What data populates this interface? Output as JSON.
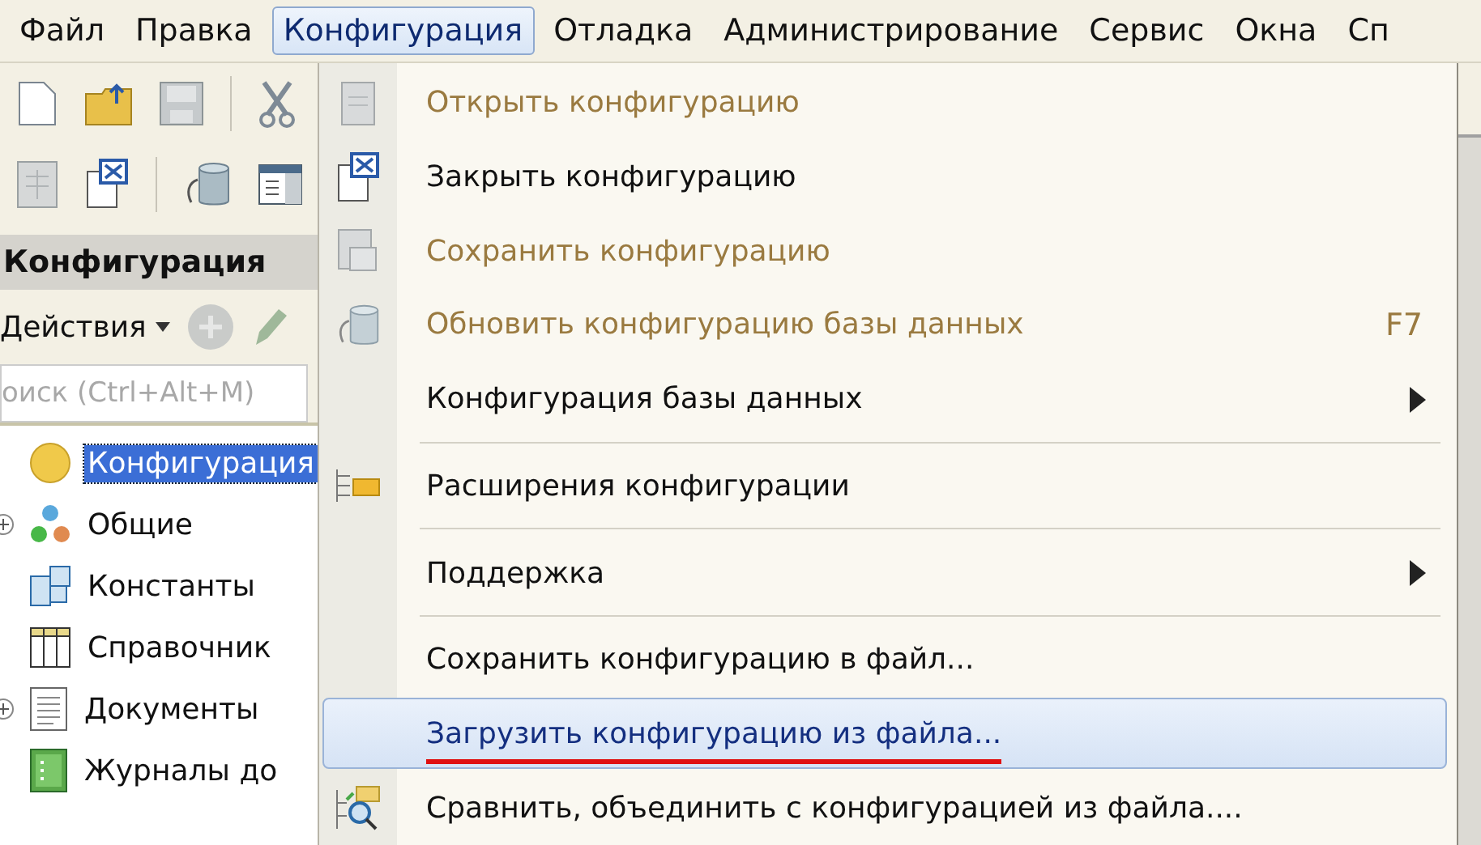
{
  "menu_bar": [
    {
      "label": "Файл",
      "selected": false
    },
    {
      "label": "Правка",
      "selected": false
    },
    {
      "label": "Конфигурация",
      "selected": true
    },
    {
      "label": "Отладка",
      "selected": false
    },
    {
      "label": "Администрирование",
      "selected": false
    },
    {
      "label": "Сервис",
      "selected": false
    },
    {
      "label": "Окна",
      "selected": false
    },
    {
      "label": "Сп",
      "selected": false
    }
  ],
  "panel": {
    "title": "Конфигурация",
    "actions_label": "Действия",
    "search": {
      "placeholder": "оиск (Ctrl+Alt+M)"
    }
  },
  "tree": {
    "label": "Конфигурация",
    "selected": true,
    "children": [
      {
        "label": "Общие",
        "selected": false,
        "collapsed": true
      },
      {
        "label": "Константы",
        "selected": false,
        "collapsed": false
      },
      {
        "label": "Справочник",
        "selected": false,
        "collapsed": false
      },
      {
        "label": "Документы",
        "selected": false,
        "collapsed": true
      },
      {
        "label": "Журналы до",
        "selected": false,
        "collapsed": false
      }
    ]
  },
  "dropdown": [
    {
      "kind": "item",
      "label": "Открыть конфигурацию",
      "disabled": true,
      "selected": false
    },
    {
      "kind": "item",
      "label": "Закрыть конфигурацию",
      "disabled": false,
      "selected": false
    },
    {
      "kind": "item",
      "label": "Сохранить конфигурацию",
      "disabled": true,
      "selected": false
    },
    {
      "kind": "item",
      "label": "Обновить конфигурацию базы данных",
      "disabled": true,
      "selected": false,
      "shortcut": "F7"
    },
    {
      "kind": "item",
      "label": "Конфигурация базы данных",
      "disabled": false,
      "selected": false,
      "submenu": true
    },
    {
      "kind": "separator"
    },
    {
      "kind": "item",
      "label": "Расширения конфигурации",
      "disabled": false,
      "selected": false
    },
    {
      "kind": "separator"
    },
    {
      "kind": "item",
      "label": "Поддержка",
      "disabled": false,
      "selected": false,
      "submenu": true
    },
    {
      "kind": "separator"
    },
    {
      "kind": "item",
      "label": "Сохранить конфигурацию в файл...",
      "disabled": false,
      "selected": false
    },
    {
      "kind": "item",
      "label": "Загрузить конфигурацию из файла...",
      "disabled": false,
      "selected": true,
      "underlined": true
    },
    {
      "kind": "item",
      "label": "Сравнить, объединить с конфигурацией из файла....",
      "disabled": false,
      "selected": false
    }
  ]
}
